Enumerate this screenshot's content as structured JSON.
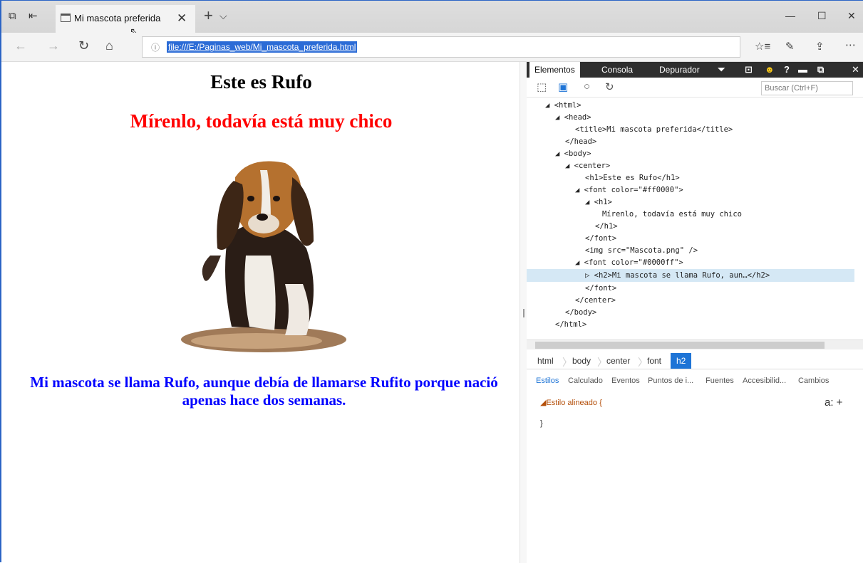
{
  "browser": {
    "tab_title": "Mi mascota preferida",
    "url": "file:///E:/Paginas_web/Mi_mascota_preferida.html"
  },
  "page": {
    "heading1": "Este es Rufo",
    "heading2": "Mírenlo, todavía está muy chico",
    "paragraph": "Mi mascota se llama Rufo, aunque debía de llamarse Rufito porque nació apenas hace dos semanas.",
    "colors": {
      "red": "#ff0000",
      "blue": "#0000ff"
    }
  },
  "devtools": {
    "tabs": [
      "Elementos",
      "Consola",
      "Depurador"
    ],
    "search_placeholder": "Buscar (Ctrl+F)",
    "dom_lines": [
      "◢ <html>",
      "◢ <head>",
      "<title>Mi mascota preferida</title>",
      "</head>",
      "◢ <body>",
      "◢ <center>",
      "<h1>Este es Rufo</h1>",
      "◢ <font color=\"#ff0000\">",
      "◢ <h1>",
      "Mírenlo, todavía está muy chico",
      "</h1>",
      "</font>",
      "<img src=\"Mascota.png\" />",
      "◢ <font color=\"#0000ff\">",
      "▷ <h2>Mi mascota se llama Rufo, aun…</h2>",
      "</font>",
      "</center>",
      "</body>",
      "</html>"
    ],
    "breadcrumbs": [
      "html",
      "body",
      "center",
      "font",
      "h2"
    ],
    "style_tabs": [
      "Estilos",
      "Calculado",
      "Eventos",
      "Puntos de i...",
      "Fuentes",
      "Accesibilid...",
      "Cambios"
    ],
    "style_rule": "◢Estilo alineado  {",
    "style_close": "}",
    "style_tools": "a:  +"
  }
}
